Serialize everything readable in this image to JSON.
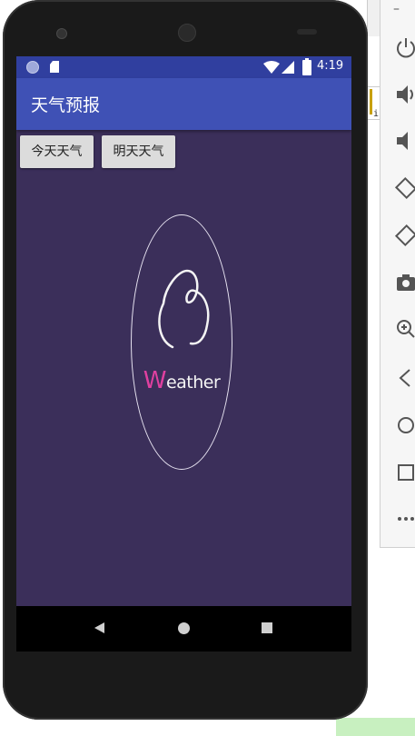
{
  "status_bar": {
    "time": "4:19",
    "icons": [
      "notification-circle-icon",
      "sd-card-icon",
      "wifi-icon",
      "signal-icon",
      "battery-icon"
    ]
  },
  "app_bar": {
    "title": "天气预报"
  },
  "buttons": {
    "today": "今天天气",
    "tomorrow": "明天天气"
  },
  "logo": {
    "wordmark_first": "W",
    "wordmark_rest": "eather"
  },
  "colors": {
    "status_bar": "#303f9f",
    "app_bar": "#3f51b5",
    "screen_background": "#3b2f5a",
    "wordmark_accent": "#e040a0"
  },
  "nav_bar": {
    "icons": [
      "back-icon",
      "home-icon",
      "recent-apps-icon"
    ]
  },
  "emulator_toolbar": {
    "icons": [
      "minimize-icon",
      "power-icon",
      "volume-up-icon",
      "volume-down-icon",
      "rotate-left-icon",
      "rotate-right-icon",
      "camera-icon",
      "zoom-icon",
      "back-icon",
      "home-icon",
      "overview-icon",
      "more-icon"
    ]
  }
}
